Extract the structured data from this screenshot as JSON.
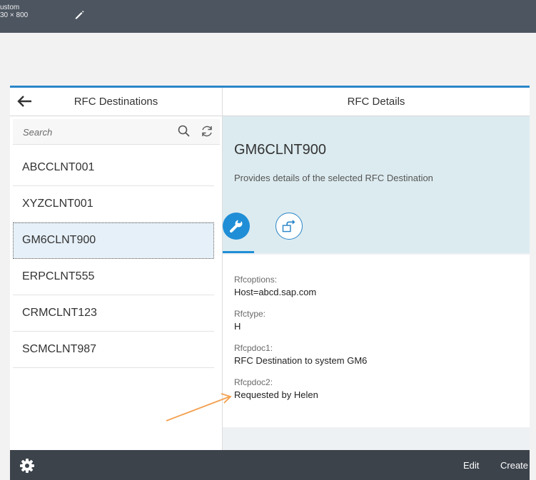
{
  "window": {
    "profile_label": "ustom",
    "size_label": "30 × 800"
  },
  "master": {
    "title": "RFC Destinations",
    "search": {
      "placeholder": "Search",
      "value": ""
    },
    "items": [
      {
        "label": "ABCCLNT001"
      },
      {
        "label": "XYZCLNT001"
      },
      {
        "label": "GM6CLNT900"
      },
      {
        "label": "ERPCLNT555"
      },
      {
        "label": "CRMCLNT123"
      },
      {
        "label": "SCMCLNT987"
      }
    ],
    "selected_index": 2
  },
  "detail": {
    "title": "RFC Details",
    "object_title": "GM6CLNT900",
    "object_subtitle": "Provides details of the selected RFC Destination",
    "fields": [
      {
        "label": "Rfcoptions:",
        "value": "Host=abcd.sap.com"
      },
      {
        "label": "Rfctype:",
        "value": "H"
      },
      {
        "label": "Rfcpdoc1:",
        "value": "RFC Destination to system GM6"
      },
      {
        "label": "Rfcpdoc2:",
        "value": "Requested by Helen"
      }
    ],
    "footer": {
      "edit_label": "Edit",
      "create_label": "Create"
    }
  },
  "icons": {
    "back": "back-arrow-icon",
    "search": "search-icon",
    "refresh": "refresh-icon",
    "settings": "gear-icon",
    "tab1": "wrench-icon",
    "tab2": "share-icon"
  },
  "colors": {
    "accent": "#1f8ed6",
    "header_blue_bg": "#dcebf0",
    "footer_bg": "#3c434b",
    "annotation_arrow": "#f4a04f"
  }
}
